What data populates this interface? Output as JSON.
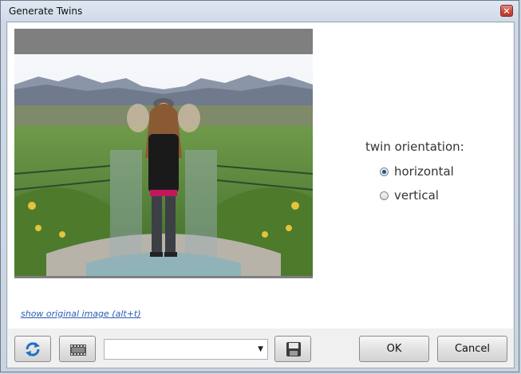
{
  "window": {
    "title": "Generate Twins",
    "close_glyph": "×"
  },
  "link": {
    "show_original": "show original image (alt+t)"
  },
  "orientation": {
    "label": "twin orientation:",
    "options": [
      {
        "label": "horizontal",
        "selected": true
      },
      {
        "label": "vertical",
        "selected": false
      }
    ]
  },
  "toolbar": {
    "refresh_icon": "refresh-icon",
    "film_icon": "film-strip-icon",
    "save_icon": "save-icon",
    "combo_value": ""
  },
  "buttons": {
    "ok": "OK",
    "cancel": "Cancel"
  },
  "colors": {
    "accent": "#2a5bb5",
    "preview_bg": "#7f7f7f",
    "radio_on": "#1e4f8f"
  }
}
